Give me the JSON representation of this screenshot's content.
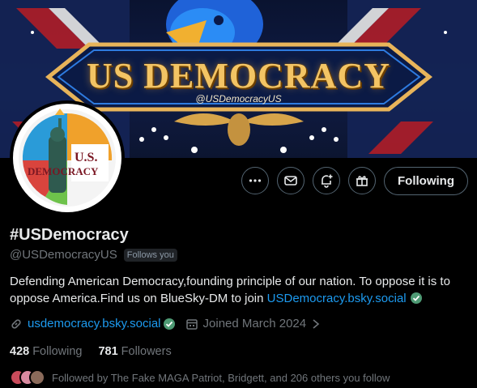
{
  "banner": {
    "title": "US DEMOCRACY",
    "handle": "@USDemocracyUS"
  },
  "avatar": {
    "line1": "U.S.",
    "line2": "DEMOCRACY"
  },
  "actions": {
    "more_icon": "more-horizontal-icon",
    "message_icon": "envelope-icon",
    "notify_icon": "bell-plus-icon",
    "subscribe_icon": "gift-icon",
    "follow_label": "Following"
  },
  "profile": {
    "name": "#USDemocracy",
    "handle": "@USDemocracyUS",
    "follows_you": "Follows you",
    "bio_text": "Defending American Democracy,founding principle of our nation. To oppose it is to oppose America.Find us on BlueSky-DM to join ",
    "bio_link": "USDemocracy.bsky.social",
    "website": "usdemocracy.bsky.social",
    "joined": "Joined March 2024"
  },
  "stats": {
    "following_count": "428",
    "following_label": "Following",
    "followers_count": "781",
    "followers_label": "Followers"
  },
  "followed_by": {
    "text": "Followed by The Fake MAGA Patriot, Bridgett, and 206 others you follow"
  },
  "colors": {
    "accent": "#1d9bf0",
    "verified": "#4e9a74",
    "banner_gold": "#f3c464"
  }
}
